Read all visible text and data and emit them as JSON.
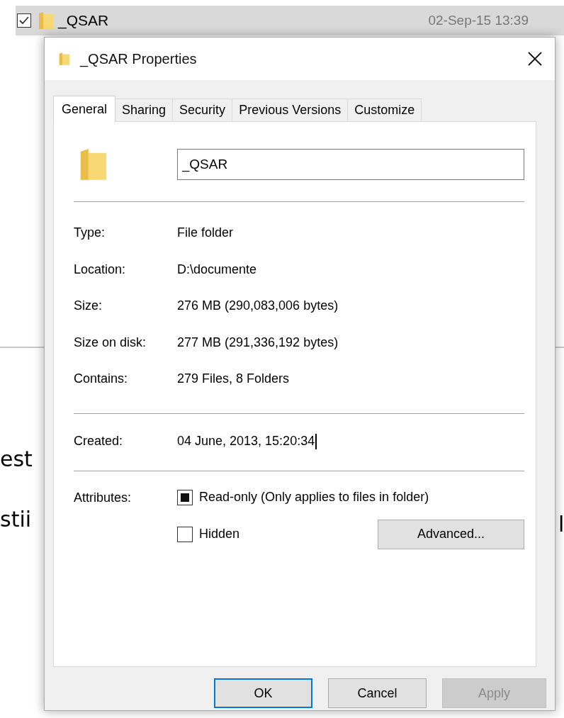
{
  "explorer_row": {
    "selected": true,
    "checked": true,
    "name": "_QSAR",
    "date_modified": "02-Sep-15 13:39"
  },
  "background_text_left": [
    "est",
    "stii"
  ],
  "background_text_right": [
    "l"
  ],
  "dialog": {
    "title": "_QSAR Properties",
    "tabs": [
      {
        "label": "General",
        "selected": true
      },
      {
        "label": "Sharing",
        "selected": false
      },
      {
        "label": "Security",
        "selected": false
      },
      {
        "label": "Previous Versions",
        "selected": false
      },
      {
        "label": "Customize",
        "selected": false
      }
    ],
    "name_field": {
      "value": "_QSAR"
    },
    "details": [
      {
        "label": "Type:",
        "value": "File folder"
      },
      {
        "label": "Location:",
        "value": "D:\\documente"
      },
      {
        "label": "Size:",
        "value": "276 MB (290,083,006 bytes)"
      },
      {
        "label": "Size on disk:",
        "value": "277 MB (291,336,192 bytes)"
      },
      {
        "label": "Contains:",
        "value": "279 Files, 8 Folders"
      }
    ],
    "created": {
      "label": "Created:",
      "value": "04 June, 2013, 15:20:34",
      "focused": true
    },
    "attributes": {
      "label": "Attributes:",
      "options": [
        {
          "label": "Read-only (Only applies to files in folder)",
          "checked": false,
          "indeterminate": true
        },
        {
          "label": "Hidden",
          "checked": false,
          "indeterminate": false
        }
      ],
      "advanced_button": "Advanced..."
    },
    "buttons": [
      {
        "label": "OK",
        "kind": "default",
        "disabled": false
      },
      {
        "label": "Cancel",
        "kind": "normal",
        "disabled": false
      },
      {
        "label": "Apply",
        "kind": "normal",
        "disabled": true
      }
    ]
  }
}
